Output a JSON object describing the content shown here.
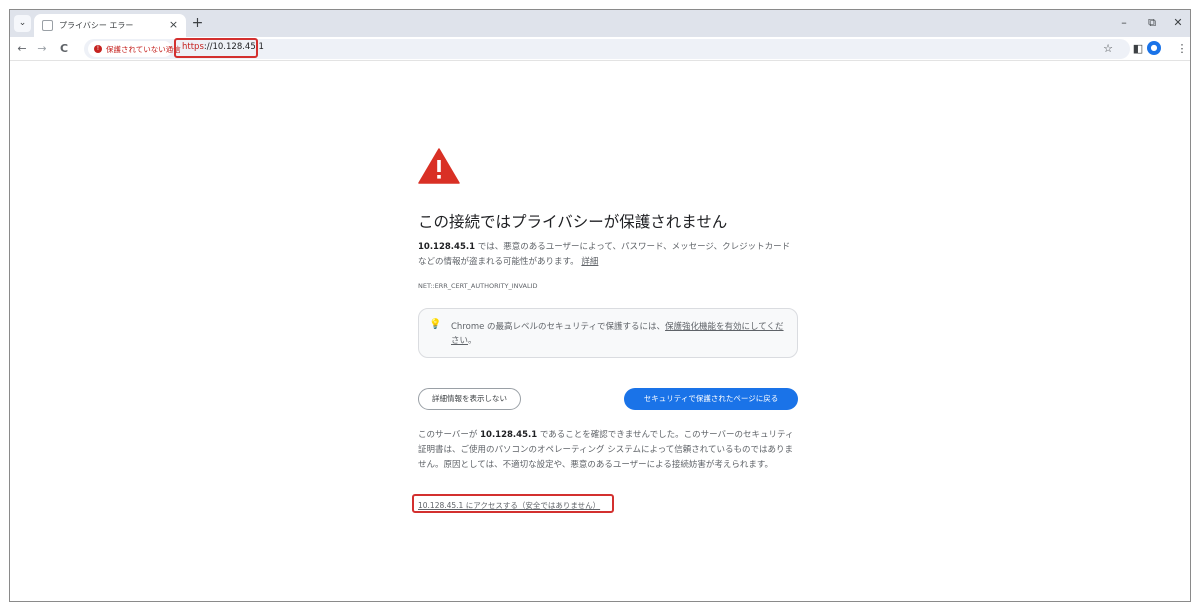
{
  "browser": {
    "tab": {
      "title": "プライバシー エラー",
      "close_glyph": "×"
    },
    "new_tab_glyph": "+",
    "tab_menu_glyph": "⌄",
    "window_controls": {
      "minimize": "–",
      "restore": "⧉",
      "close": "✕"
    },
    "nav": {
      "back": "←",
      "forward": "→",
      "reload": "C"
    },
    "security_chip": {
      "label": "保護されていない通信",
      "icon": "warning-circle-icon",
      "color": "#c5221f"
    },
    "url": {
      "scheme": "https",
      "rest": "://10.128.45.1"
    },
    "toolbar_icons": {
      "bookmark": "☆",
      "side_panel": "◧",
      "menu": "⋮"
    },
    "accent_color": "#1a73e8"
  },
  "interstitial": {
    "heading": "この接続ではプライバシーが保護されません",
    "host": "10.128.45.1",
    "explanation": " では、悪意のあるユーザーによって、パスワード、メッセージ、クレジットカードなどの情報が盗まれる可能性があります。",
    "learn_more": "詳細",
    "error_code": "NET::ERR_CERT_AUTHORITY_INVALID",
    "promo": {
      "icon": "lightbulb-icon",
      "text": "Chrome の最高レベルのセキュリティで保護するには、",
      "link": "保護強化機能を有効にしてください",
      "suffix": "。"
    },
    "hide_details_button": "詳細情報を表示しない",
    "back_to_safety_button": "セキュリティで保護されたページに戻る",
    "details_prefix": "このサーバーが ",
    "details_host": "10.128.45.1",
    "details_suffix": " であることを確認できませんでした。このサーバーのセキュリティ証明書は、ご使用のパソコンのオペレーティング システムによって信頼されているものではありません。原因としては、不適切な設定や、悪意のあるユーザーによる接続妨害が考えられます。",
    "proceed_link": "10.128.45.1 にアクセスする（安全ではありません）"
  }
}
